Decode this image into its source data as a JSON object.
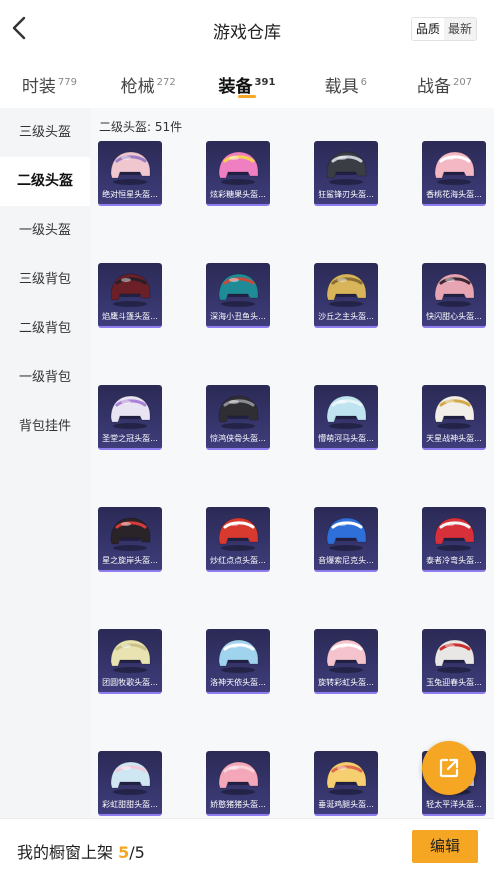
{
  "header": {
    "title": "游戏仓库",
    "sort": {
      "options": [
        "品质",
        "最新"
      ],
      "selected": "品质"
    }
  },
  "tabs": [
    {
      "label": "时装",
      "count": "779",
      "active": false
    },
    {
      "label": "枪械",
      "count": "272",
      "active": false
    },
    {
      "label": "装备",
      "count": "391",
      "active": true
    },
    {
      "label": "载具",
      "count": "6",
      "active": false
    },
    {
      "label": "战备",
      "count": "207",
      "active": false
    }
  ],
  "sidebar": {
    "items": [
      {
        "label": "三级头盔",
        "active": false
      },
      {
        "label": "二级头盔",
        "active": true
      },
      {
        "label": "一级头盔",
        "active": false
      },
      {
        "label": "三级背包",
        "active": false
      },
      {
        "label": "二级背包",
        "active": false
      },
      {
        "label": "一级背包",
        "active": false
      },
      {
        "label": "背包挂件",
        "active": false
      }
    ]
  },
  "content": {
    "section_label": "二级头盔: 51件",
    "items": [
      {
        "name": "绝对恒星头盔...",
        "color": "#f0c6cf",
        "accent": "#9b7ec2"
      },
      {
        "name": "炫彩糖果头盔...",
        "color": "#f07fc2",
        "accent": "#f4d34f"
      },
      {
        "name": "狂鲨锋刃头盔...",
        "color": "#3a3d44",
        "accent": "#c9ced6"
      },
      {
        "name": "香桃花海头盔...",
        "color": "#f4b7c4",
        "accent": "#ffffff"
      },
      {
        "name": "焰鹰斗篷头盔...",
        "color": "#6b1f27",
        "accent": "#2a1e26"
      },
      {
        "name": "深海小丑鱼头...",
        "color": "#1f8b97",
        "accent": "#c94a3a"
      },
      {
        "name": "沙丘之主头盔...",
        "color": "#d8b55a",
        "accent": "#8a6d30"
      },
      {
        "name": "快闪甜心头盔...",
        "color": "#e7a4b3",
        "accent": "#3a2a33"
      },
      {
        "name": "圣堂之冠头盔...",
        "color": "#e8e4f2",
        "accent": "#a982d8"
      },
      {
        "name": "惊鸿侠骨头盔...",
        "color": "#2f2f33",
        "accent": "#8c8c93"
      },
      {
        "name": "懵萌河马头盔...",
        "color": "#bfe3ef",
        "accent": "#e6f4fa"
      },
      {
        "name": "天星战神头盔...",
        "color": "#f1efe7",
        "accent": "#d4a94a"
      },
      {
        "name": "星之旋岸头盔...",
        "color": "#2a2328",
        "accent": "#d63a3a"
      },
      {
        "name": "炒红点点头盔...",
        "color": "#d93a30",
        "accent": "#ffffff"
      },
      {
        "name": "音爆索尼克头...",
        "color": "#2e6fd9",
        "accent": "#ffffff"
      },
      {
        "name": "泰者冷弯头盔...",
        "color": "#d8303a",
        "accent": "#f3f3f3"
      },
      {
        "name": "团圆牧歌头盔...",
        "color": "#e8e3b0",
        "accent": "#c9c28a"
      },
      {
        "name": "洛神天依头盔...",
        "color": "#9fd3ee",
        "accent": "#ffffff"
      },
      {
        "name": "旋转彩虹头盔...",
        "color": "#f5c3cd",
        "accent": "#ffffff"
      },
      {
        "name": "玉兔迎春头盔...",
        "color": "#e9e6e6",
        "accent": "#cc2f2f"
      },
      {
        "name": "彩虹甜甜头盔...",
        "color": "#cfe6f3",
        "accent": "#f2c9da"
      },
      {
        "name": "娇憨猪猪头盔...",
        "color": "#f3a7b8",
        "accent": "#f8d0da"
      },
      {
        "name": "垂涎鸡腿头盔...",
        "color": "#f5cf70",
        "accent": "#e06a4a"
      },
      {
        "name": "轻太平洋头盔...",
        "color": "#d8d8de",
        "accent": "#d13a3a"
      }
    ]
  },
  "bottom": {
    "label": "我的橱窗上架",
    "current": "5",
    "separator": "/",
    "total": "5",
    "edit_label": "编辑"
  },
  "colors": {
    "accent": "#f5a623",
    "card_bg": "#35346a",
    "card_border": "#8f7cf0"
  },
  "icons": {
    "back": "chevron-left-icon",
    "share": "external-link-icon"
  }
}
